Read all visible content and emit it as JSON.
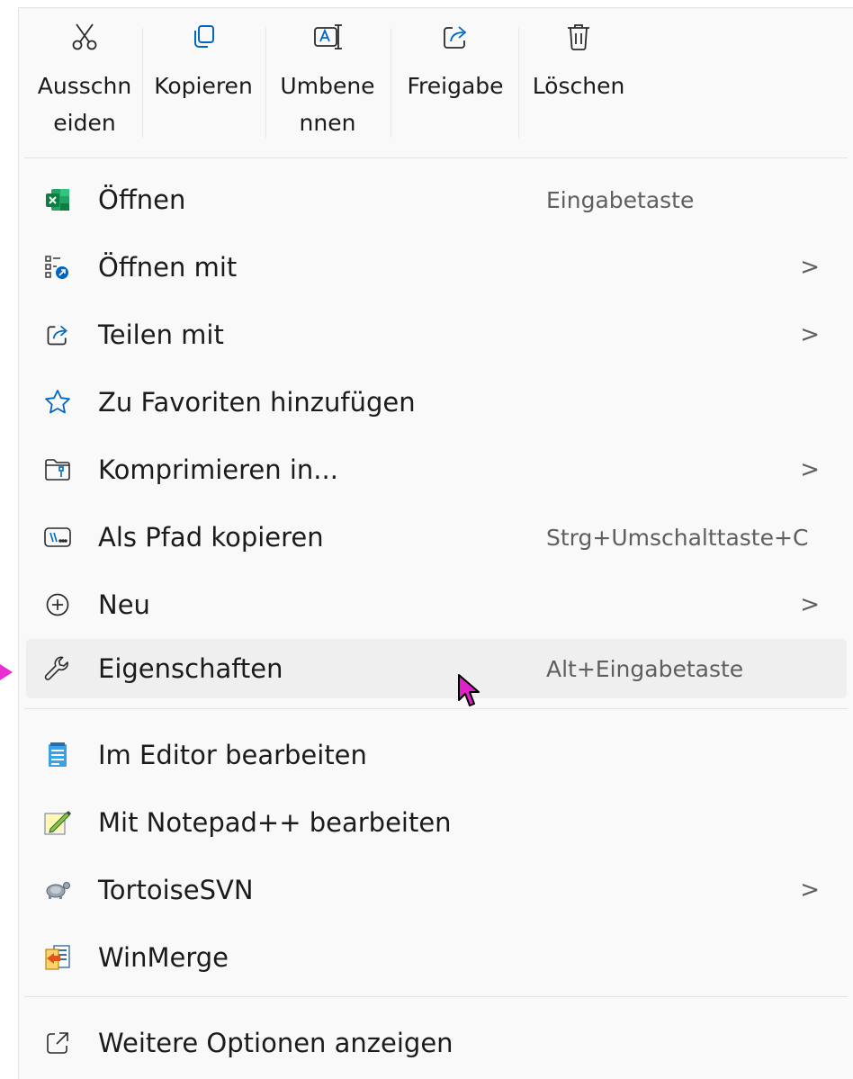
{
  "toolbar": {
    "cut_label_line1": "Ausschn",
    "cut_label_line2": "eiden",
    "copy_label": "Kopieren",
    "rename_label_line1": "Umbene",
    "rename_label_line2": "nnen",
    "share_label": "Freigabe",
    "delete_label": "Löschen"
  },
  "items": [
    {
      "label": "Öffnen",
      "shortcut": "Eingabetaste",
      "icon": "excel-icon"
    },
    {
      "label": "Öffnen mit",
      "icon": "open-with-icon",
      "submenu": true
    },
    {
      "label": "Teilen mit",
      "icon": "share-icon",
      "submenu": true
    },
    {
      "label": "Zu Favoriten hinzufügen",
      "icon": "star-icon"
    },
    {
      "label": "Komprimieren in...",
      "icon": "zip-folder-icon",
      "submenu": true
    },
    {
      "label": "Als Pfad kopieren",
      "shortcut": "Strg+Umschalttaste+C",
      "icon": "path-icon"
    },
    {
      "label": "Neu",
      "icon": "plus-circle-icon",
      "submenu": true
    },
    {
      "label": "Eigenschaften",
      "shortcut": "Alt+Eingabetaste",
      "icon": "wrench-icon"
    },
    {
      "label": "Im Editor bearbeiten",
      "icon": "notepad-icon"
    },
    {
      "label": "Mit Notepad++ bearbeiten",
      "icon": "notepadpp-icon"
    },
    {
      "label": "TortoiseSVN",
      "icon": "tortoise-icon",
      "submenu": true
    },
    {
      "label": "WinMerge",
      "icon": "winmerge-icon"
    },
    {
      "label": "Weitere Optionen anzeigen",
      "icon": "more-options-icon"
    }
  ],
  "chevron": ">",
  "colors": {
    "accent": "#0067c0",
    "highlight_marker": "#ea2fd2",
    "cursor": "#e020c8"
  }
}
